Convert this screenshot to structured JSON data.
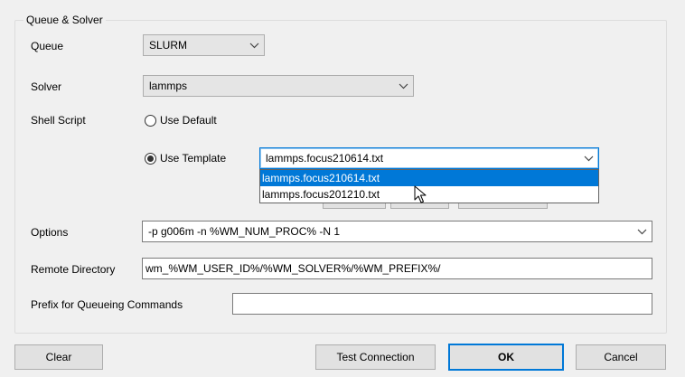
{
  "group": {
    "title": "Queue & Solver"
  },
  "queue": {
    "label": "Queue",
    "value": "SLURM"
  },
  "solver": {
    "label": "Solver",
    "value": "lammps"
  },
  "shell_script": {
    "label": "Shell Script",
    "use_default_label": "Use Default",
    "use_template_label": "Use Template",
    "selected_option": "Use Template",
    "template_value": "lammps.focus210614.txt",
    "template_options": [
      "lammps.focus210614.txt",
      "lammps.focus201210.txt"
    ],
    "highlighted_option": "lammps.focus210614.txt"
  },
  "options": {
    "label": "Options",
    "value": "-p g006m -n %WM_NUM_PROC% -N 1"
  },
  "remote_directory": {
    "label": "Remote Directory",
    "value": "wm_%WM_USER_ID%/%WM_SOLVER%/%WM_PREFIX%/"
  },
  "prefix": {
    "label": "Prefix for Queueing Commands",
    "value": ""
  },
  "buttons": {
    "clear": "Clear",
    "test_connection": "Test Connection",
    "ok": "OK",
    "cancel": "Cancel"
  },
  "icons": {
    "dropdown": "chevron-down-icon",
    "cursor": "mouse-pointer-icon"
  },
  "colors": {
    "selection": "#0078d7",
    "focus_border": "#0078d7",
    "background": "#f0f0f0"
  }
}
